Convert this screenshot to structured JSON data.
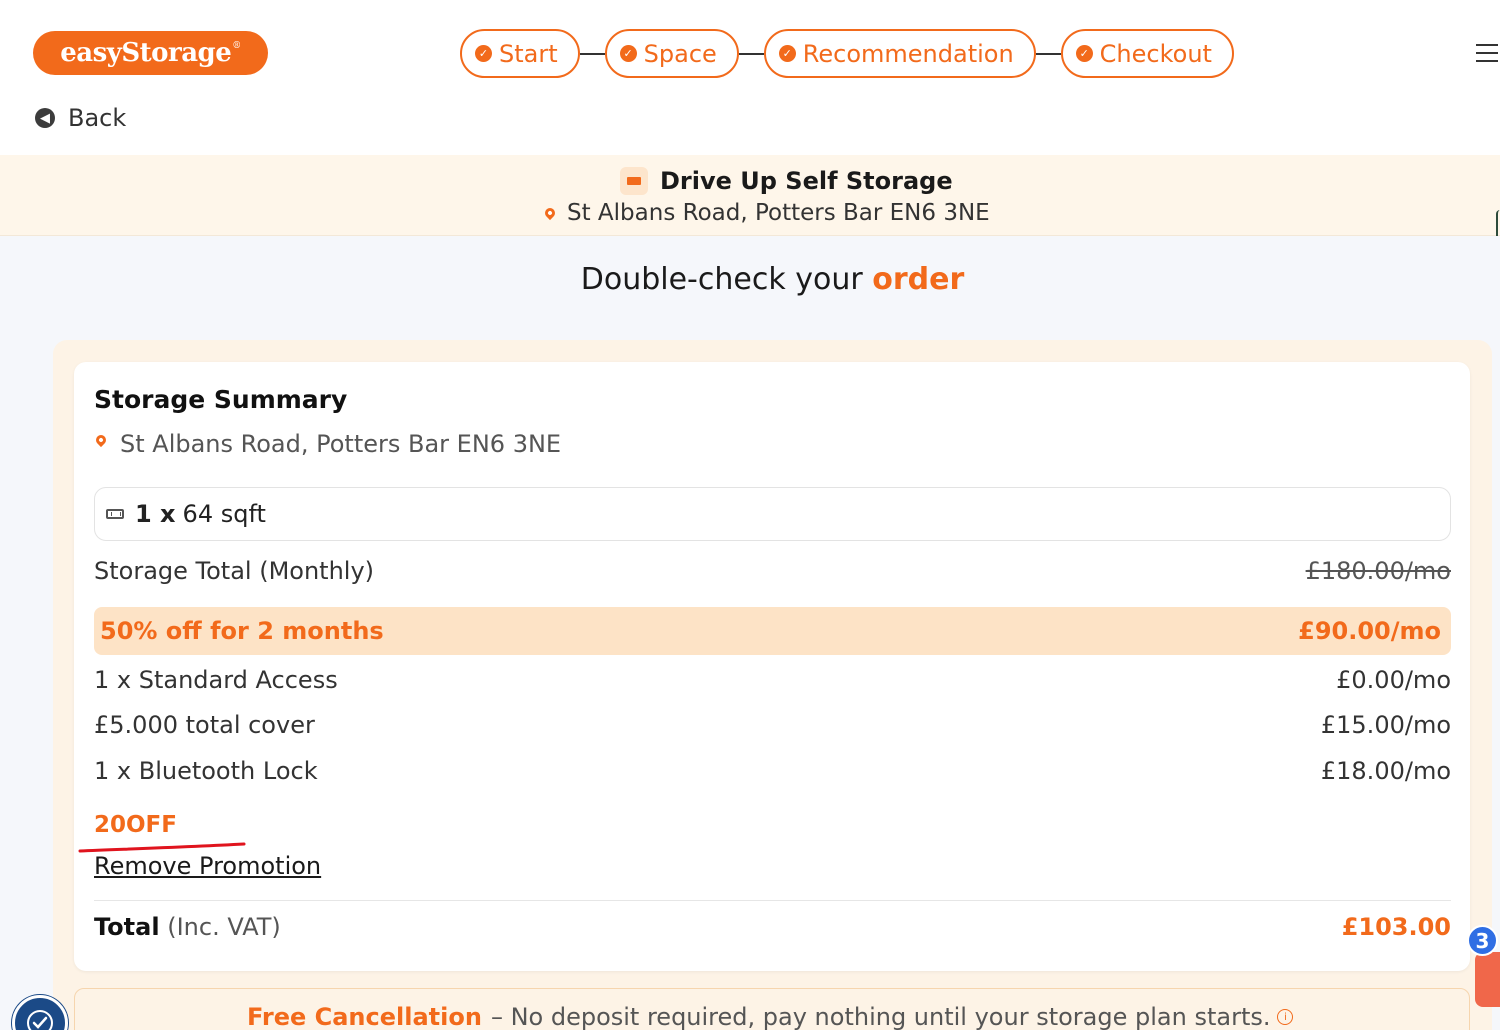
{
  "header": {
    "logo_text": "easyStorage",
    "logo_mark": "®",
    "steps": [
      {
        "label": "Start",
        "icon": "check-icon"
      },
      {
        "label": "Space",
        "icon": "check-icon"
      },
      {
        "label": "Recommendation",
        "icon": "check-icon"
      },
      {
        "label": "Checkout",
        "icon": "check-icon"
      }
    ],
    "back_label": "Back",
    "menu_icon": "hamburger-icon"
  },
  "location": {
    "name": "Drive Up Self Storage",
    "address": "St Albans Road, Potters Bar EN6 3NE"
  },
  "page": {
    "title_prefix": "Double-check your",
    "title_highlight": "order"
  },
  "summary": {
    "title": "Storage Summary",
    "address": "St Albans Road, Potters Bar EN6 3NE",
    "unit_qty": "1 x",
    "unit_size": "64 sqft",
    "storage_total_label": "Storage Total (Monthly)",
    "storage_total_value": "£180.00/mo",
    "promo_label": "50% off for 2 months",
    "promo_value": "£90.00/mo",
    "line_items": [
      {
        "label": "1 x Standard Access",
        "value": "£0.00/mo"
      },
      {
        "label": "£5.000 total cover",
        "value": "£15.00/mo"
      },
      {
        "label": "1 x Bluetooth Lock",
        "value": "£18.00/mo"
      }
    ],
    "promo_code": "20OFF",
    "remove_promotion": "Remove Promotion",
    "total_label": "Total",
    "total_note": "(Inc. VAT)",
    "total_value": "£103.00"
  },
  "cancellation": {
    "title": "Free Cancellation",
    "text": "– No deposit required, pay nothing until your storage plan starts."
  },
  "widgets": {
    "chat_badge_count": "3"
  },
  "colors": {
    "brand": "#f26a1b",
    "banner_bg": "#fef6ea",
    "promo_bg": "#fde3c6",
    "chat_blue": "#2f6ee4"
  }
}
